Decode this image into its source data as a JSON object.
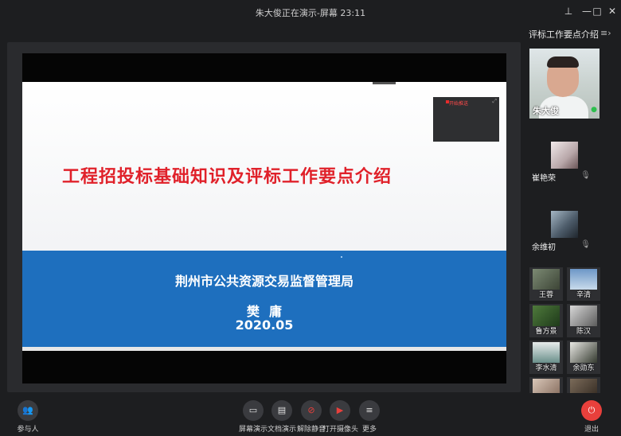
{
  "window": {
    "title": "朱大俊正在演示-屏幕 23:11"
  },
  "window_controls": {
    "pin": "⊥",
    "minimize": "—",
    "maximize": "□",
    "close": "✕"
  },
  "slide": {
    "title": "工程招投标基础知识及评标工作要点介绍",
    "organization": "荆州市公共资源交易监督管理局",
    "author": "樊庸",
    "date": "2020.05",
    "mini_window_label": "开始推送"
  },
  "sidebar": {
    "meeting_title": "评标工作要点介绍",
    "menu_icon": "≡›",
    "speaker": {
      "name": "朱大俊"
    },
    "participants": [
      {
        "name": "崔艳荣"
      },
      {
        "name": "余维初"
      }
    ],
    "tiles": [
      {
        "name": "王蓉"
      },
      {
        "name": "辛清"
      },
      {
        "name": "鲁方景"
      },
      {
        "name": "陈汉"
      },
      {
        "name": "李水清"
      },
      {
        "name": "余勋东"
      }
    ]
  },
  "toolbar": {
    "participants_label": "参与人",
    "screen_share_label": "屏幕演示",
    "doc_share_label": "文档演示",
    "unmute_label": "解除静音",
    "camera_label": "打开摄像头",
    "more_label": "更多",
    "exit_label": "退出"
  },
  "colors": {
    "title_red": "#e0212a",
    "band_blue": "#1e6fbe",
    "exit_red": "#e8403c",
    "mic_active": "#2dbf4e"
  }
}
